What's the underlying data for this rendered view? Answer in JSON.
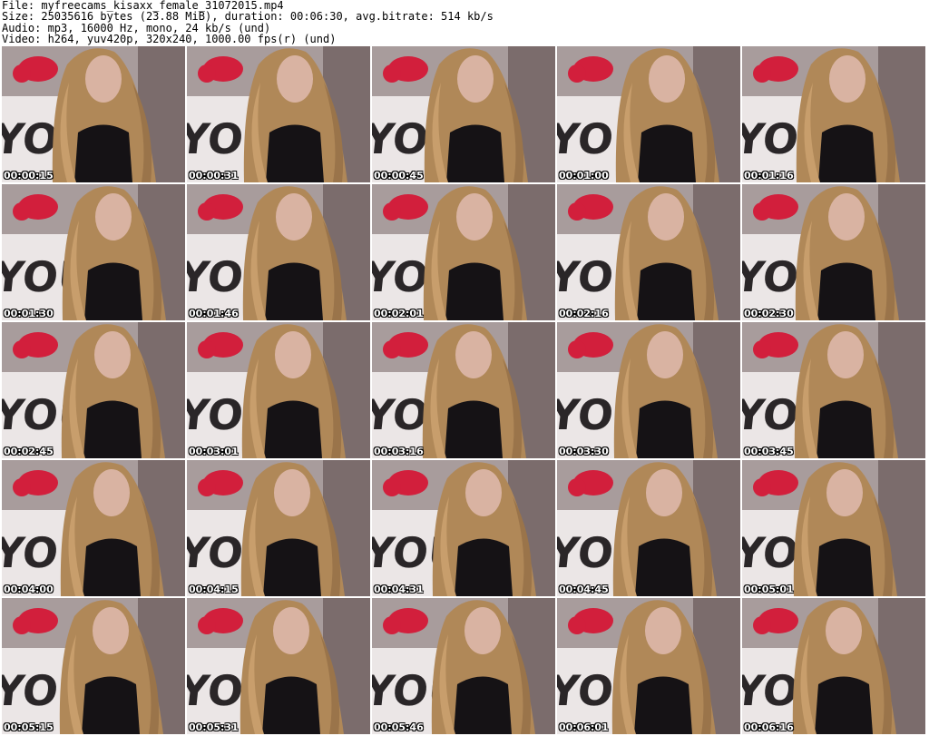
{
  "header": {
    "file_line": "File: myfreecams_kisaxx_female_31072015.mp4",
    "size_line": "Size: 25035616 bytes (23.88 MiB), duration: 00:06:30, avg.bitrate: 514 kb/s",
    "audio_line": "Audio: mp3, 16000 Hz, mono, 24 kb/s (und)",
    "video_line": "Video: h264, yuv420p, 320x240, 1000.00 fps(r) (und)"
  },
  "thumbnails": [
    {
      "timestamp": "00:00:15"
    },
    {
      "timestamp": "00:00:31"
    },
    {
      "timestamp": "00:00:45"
    },
    {
      "timestamp": "00:01:00"
    },
    {
      "timestamp": "00:01:16"
    },
    {
      "timestamp": "00:01:30"
    },
    {
      "timestamp": "00:01:46"
    },
    {
      "timestamp": "00:02:01"
    },
    {
      "timestamp": "00:02:16"
    },
    {
      "timestamp": "00:02:30"
    },
    {
      "timestamp": "00:02:45"
    },
    {
      "timestamp": "00:03:01"
    },
    {
      "timestamp": "00:03:16"
    },
    {
      "timestamp": "00:03:30"
    },
    {
      "timestamp": "00:03:45"
    },
    {
      "timestamp": "00:04:00"
    },
    {
      "timestamp": "00:04:15"
    },
    {
      "timestamp": "00:04:31"
    },
    {
      "timestamp": "00:04:45"
    },
    {
      "timestamp": "00:05:01"
    },
    {
      "timestamp": "00:05:15"
    },
    {
      "timestamp": "00:05:31"
    },
    {
      "timestamp": "00:05:46"
    },
    {
      "timestamp": "00:06:01"
    },
    {
      "timestamp": "00:06:16"
    }
  ],
  "pillow_text": "YOU",
  "colors": {
    "pillow_red": "#d21f3c",
    "hair_blond": "#b08858",
    "shirt_black": "#151215",
    "background": "#ffffff"
  }
}
